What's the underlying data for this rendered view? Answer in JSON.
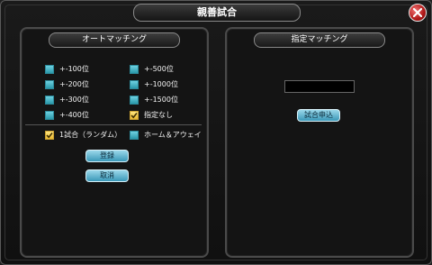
{
  "window": {
    "title": "親善試合"
  },
  "auto_matching": {
    "header": "オートマッチング",
    "options": [
      {
        "label": "+-100位",
        "checked": false
      },
      {
        "label": "+-500位",
        "checked": false
      },
      {
        "label": "+-200位",
        "checked": false
      },
      {
        "label": "+-1000位",
        "checked": false
      },
      {
        "label": "+-300位",
        "checked": false
      },
      {
        "label": "+-1500位",
        "checked": false
      },
      {
        "label": "+-400位",
        "checked": false
      },
      {
        "label": "指定なし",
        "checked": true
      }
    ],
    "mode_options": [
      {
        "label": "1試合（ランダム）",
        "checked": true
      },
      {
        "label": "ホーム＆アウェイ",
        "checked": false
      }
    ],
    "register_label": "登録",
    "cancel_label": "取消"
  },
  "specified_matching": {
    "header": "指定マッチング",
    "input_value": "",
    "apply_label": "試合申込"
  }
}
